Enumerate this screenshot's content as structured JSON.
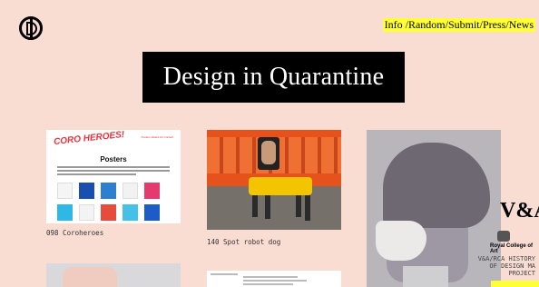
{
  "header": {
    "nav": [
      "Info",
      "Random",
      "Submit",
      "Press",
      "News"
    ],
    "nav_separator": " /",
    "title": "Design in Quarantine"
  },
  "logo": {
    "icon": "dq-monogram-icon"
  },
  "cards": [
    {
      "caption": "098 Coroheroes",
      "screenshot": {
        "brand": "CORO HEROES!",
        "links": "Posters  Masks  Art  Contact",
        "heading": "Posters"
      }
    },
    {
      "caption": "140 Spot robot dog"
    },
    {
      "caption": ""
    }
  ],
  "sponsors": {
    "va": "V&A",
    "rca": "Royal College of Art",
    "program": [
      "V&A/RCA HISTORY",
      "OF DESIGN MA",
      "PROJECT"
    ]
  },
  "colors": {
    "background": "#f9ddd2",
    "highlight": "#ffff33",
    "title_bg": "#000000"
  }
}
